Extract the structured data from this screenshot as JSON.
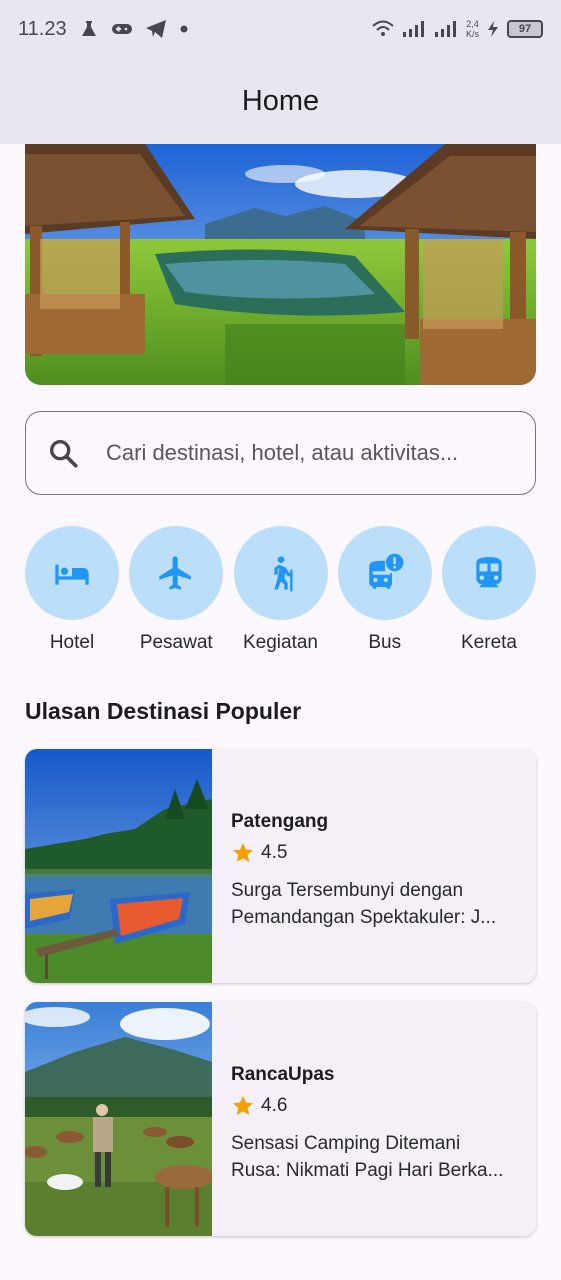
{
  "status_bar": {
    "time": "11.23",
    "net_speed_value": "2,4",
    "net_speed_unit": "K/s",
    "battery": "97",
    "icons": [
      "flask-icon",
      "gamepad-icon",
      "telegram-icon",
      "dot-icon",
      "wifi-icon",
      "signal-icon",
      "signal-icon",
      "charging-icon",
      "battery-icon"
    ]
  },
  "app_bar": {
    "title": "Home"
  },
  "search": {
    "placeholder": "Cari destinasi, hotel, atau aktivitas..."
  },
  "categories": [
    {
      "label": "Hotel",
      "icon": "bed-icon"
    },
    {
      "label": "Pesawat",
      "icon": "airplane-icon"
    },
    {
      "label": "Kegiatan",
      "icon": "hiking-icon"
    },
    {
      "label": "Bus",
      "icon": "bus-alert-icon"
    },
    {
      "label": "Kereta",
      "icon": "train-icon"
    }
  ],
  "section_title": "Ulasan Destinasi Populer",
  "reviews": [
    {
      "name": "Patengang",
      "rating": "4.5",
      "desc_line1": "Surga Tersembunyi dengan",
      "desc_line2": "Pemandangan Spektakuler: J..."
    },
    {
      "name": "RancaUpas",
      "rating": "4.6",
      "desc_line1": "Sensasi Camping Ditemani",
      "desc_line2": "Rusa: Nikmati Pagi Hari Berka..."
    }
  ],
  "colors": {
    "category_bg": "#bbdefb",
    "category_icon": "#2196f3",
    "star": "#f59f00",
    "card_bg": "#f5eff7",
    "app_bar_bg": "#e9e6ef"
  }
}
